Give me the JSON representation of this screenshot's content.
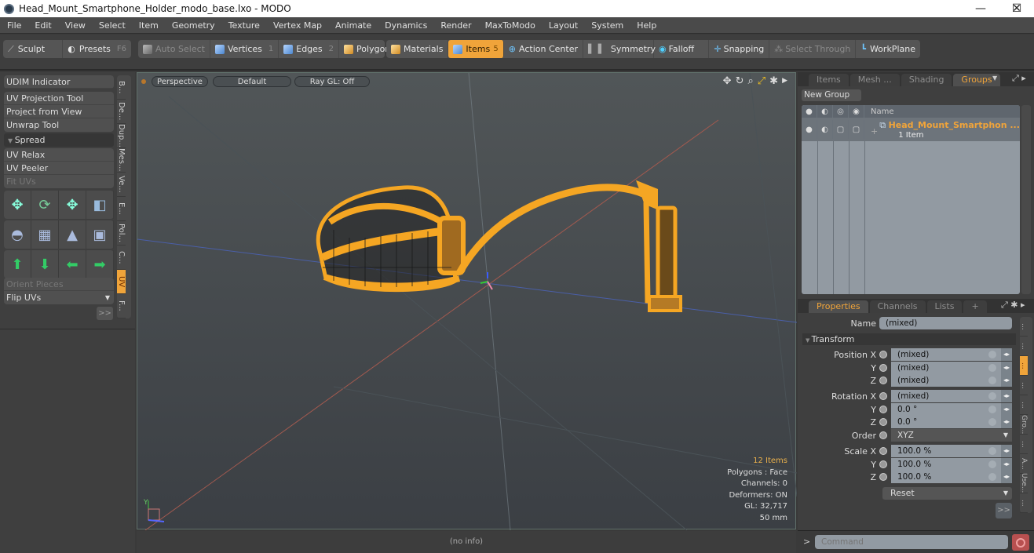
{
  "window": {
    "title": "Head_Mount_Smartphone_Holder_modo_base.lxo - MODO",
    "controls": {
      "minimize": "—",
      "maximize": "☐",
      "close": "✕"
    }
  },
  "menu": [
    "File",
    "Edit",
    "View",
    "Select",
    "Item",
    "Geometry",
    "Texture",
    "Vertex Map",
    "Animate",
    "Dynamics",
    "Render",
    "MaxToModo",
    "Layout",
    "System",
    "Help"
  ],
  "toolbar": {
    "sculpt": "Sculpt",
    "presets": "Presets",
    "presets_key": "F6",
    "auto_select": "Auto Select",
    "vertices": "Vertices",
    "vertices_key": "1",
    "edges": "Edges",
    "edges_key": "2",
    "polygons": "Polygons",
    "materials": "Materials",
    "items": "Items",
    "items_key": "5",
    "action_center": "Action Center",
    "symmetry": "Symmetry",
    "falloff": "Falloff",
    "snapping": "Snapping",
    "select_through": "Select Through",
    "workplane": "WorkPlane"
  },
  "left_panel": {
    "udim": "UDIM Indicator",
    "tools": [
      "UV Projection Tool",
      "Project from View",
      "Unwrap Tool"
    ],
    "spread_header": "Spread",
    "tools2": [
      "UV Relax",
      "UV Peeler",
      "Fit UVs"
    ],
    "orient_pieces": "Orient Pieces",
    "flip_uvs": "Flip UVs",
    "more": ">>",
    "vtabs": [
      "B...",
      "De...",
      "Dup...",
      "Mes...",
      "Ve...",
      "E...",
      "Pol...",
      "C...",
      "UV",
      "F..."
    ],
    "active_vtab": "UV"
  },
  "viewport": {
    "view": "Perspective",
    "shading": "Default",
    "raygl": "Ray GL: Off",
    "stats": {
      "items": "12 Items",
      "polygons": "Polygons : Face",
      "channels": "Channels: 0",
      "deformers": "Deformers: ON",
      "gl": "GL: 32,717",
      "scale": "50 mm"
    },
    "status": "(no info)",
    "axis_label": "Y"
  },
  "right_panel": {
    "top_tabs": [
      "Items",
      "Mesh ...",
      "Shading",
      "Groups"
    ],
    "active_top_tab": "Groups",
    "new_group": "New Group",
    "list_header_name": "Name",
    "group": {
      "name": "Head_Mount_Smartphon ...",
      "count": "1 Item"
    },
    "prop_tabs": [
      "Properties",
      "Channels",
      "Lists"
    ],
    "active_prop_tab": "Properties",
    "name_label": "Name",
    "name_value": "(mixed)",
    "transform_header": "Transform",
    "position": {
      "label_x": "Position X",
      "x": "(mixed)",
      "y": "(mixed)",
      "z": "(mixed)"
    },
    "rotation": {
      "label_x": "Rotation X",
      "x": "(mixed)",
      "y": "0.0 °",
      "z": "0.0 °"
    },
    "order": {
      "label": "Order",
      "value": "XYZ"
    },
    "scale": {
      "label_x": "Scale X",
      "x": "100.0 %",
      "y": "100.0 %",
      "z": "100.0 %"
    },
    "y_label": "Y",
    "z_label": "Z",
    "reset": "Reset",
    "more": ">>",
    "rvtabs": [
      "...",
      "...",
      "...",
      "...",
      "...",
      "Gro...",
      "...",
      "A...",
      "Use...",
      "..."
    ],
    "command_placeholder": "Command",
    "prompt": ">"
  },
  "colors": {
    "accent": "#f0a43a",
    "wireframe": "#f5a623"
  }
}
